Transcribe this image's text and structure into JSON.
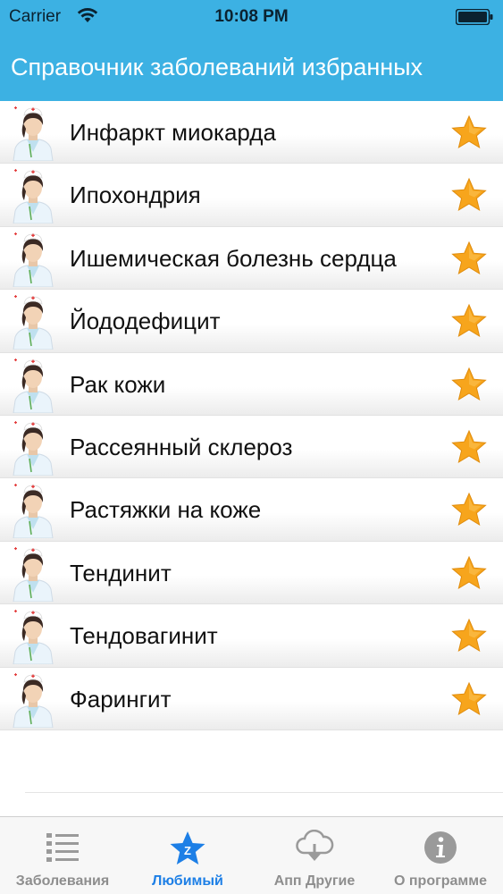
{
  "status_bar": {
    "carrier": "Carrier",
    "time": "10:08 PM"
  },
  "nav": {
    "title": "Справочник заболеваний избранных"
  },
  "list_items": [
    {
      "label": "Инфаркт миокарда"
    },
    {
      "label": "Ипохондрия"
    },
    {
      "label": "Ишемическая болезнь сердца"
    },
    {
      "label": "Йододефицит"
    },
    {
      "label": "Рак кожи"
    },
    {
      "label": "Рассеянный склероз"
    },
    {
      "label": "Растяжки на коже"
    },
    {
      "label": "Тендинит"
    },
    {
      "label": "Тендовагинит"
    },
    {
      "label": "Фарингит"
    }
  ],
  "tabs": [
    {
      "label": "Заболевания",
      "icon": "list-icon"
    },
    {
      "label": "Любимый",
      "icon": "favorites-star-icon",
      "active": true
    },
    {
      "label": "Апп Другие",
      "icon": "cloud-download-icon"
    },
    {
      "label": "О программе",
      "icon": "info-icon"
    }
  ],
  "colors": {
    "header": "#3cb1e3",
    "star": "#f7a51c",
    "active_tab": "#1d7fe6",
    "inactive_tab": "#8e8e8e"
  }
}
